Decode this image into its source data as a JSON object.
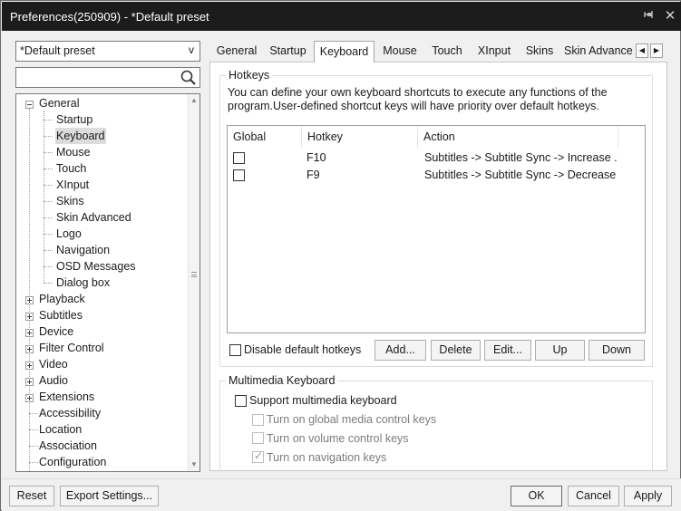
{
  "window": {
    "title": "Preferences(250909) - *Default preset",
    "pin_icon": "pin-icon",
    "close_icon": "close-icon"
  },
  "sidebar": {
    "preset_value": "*Default preset",
    "preset_arrow": "v",
    "search_value": "",
    "search_icon": "search-icon",
    "tree": [
      {
        "label": "General",
        "expanded": true,
        "children": [
          "Startup",
          "Keyboard",
          "Mouse",
          "Touch",
          "XInput",
          "Skins",
          "Skin Advanced",
          "Logo",
          "Navigation",
          "OSD Messages",
          "Dialog box"
        ],
        "selected_child": "Keyboard"
      },
      {
        "label": "Playback",
        "expanded": false
      },
      {
        "label": "Subtitles",
        "expanded": false
      },
      {
        "label": "Device",
        "expanded": false
      },
      {
        "label": "Filter Control",
        "expanded": false
      },
      {
        "label": "Video",
        "expanded": false
      },
      {
        "label": "Audio",
        "expanded": false
      },
      {
        "label": "Extensions",
        "expanded": false
      },
      {
        "label": "Accessibility"
      },
      {
        "label": "Location"
      },
      {
        "label": "Association"
      },
      {
        "label": "Configuration"
      }
    ]
  },
  "tabs": {
    "items": [
      "General",
      "Startup",
      "Keyboard",
      "Mouse",
      "Touch",
      "XInput",
      "Skins",
      "Skin Advance"
    ],
    "active": "Keyboard",
    "scroll_left": "◀",
    "scroll_right": "▶"
  },
  "hotkeys": {
    "group_label": "Hotkeys",
    "description": "You can define your own keyboard shortcuts to execute any functions of the program.User-defined shortcut keys will have priority over default hotkeys.",
    "columns": [
      "Global",
      "Hotkey",
      "Action"
    ],
    "rows": [
      {
        "global": false,
        "hotkey": "F10",
        "action": "Subtitles -> Subtitle Sync -> Increase ..."
      },
      {
        "global": false,
        "hotkey": "F9",
        "action": "Subtitles -> Subtitle Sync -> Decrease..."
      }
    ],
    "disable_default_label": "Disable default hotkeys",
    "disable_default_checked": false,
    "buttons": {
      "add": "Add...",
      "delete": "Delete",
      "edit": "Edit...",
      "up": "Up",
      "down": "Down"
    }
  },
  "multimedia": {
    "group_label": "Multimedia Keyboard",
    "support_label": "Support multimedia keyboard",
    "support_checked": false,
    "options": [
      {
        "label": "Turn on global media control keys",
        "checked": false
      },
      {
        "label": "Turn on volume control keys",
        "checked": false
      },
      {
        "label": "Turn on navigation keys",
        "checked": true
      }
    ]
  },
  "footer": {
    "reset": "Reset",
    "export": "Export Settings...",
    "ok": "OK",
    "cancel": "Cancel",
    "apply": "Apply"
  }
}
